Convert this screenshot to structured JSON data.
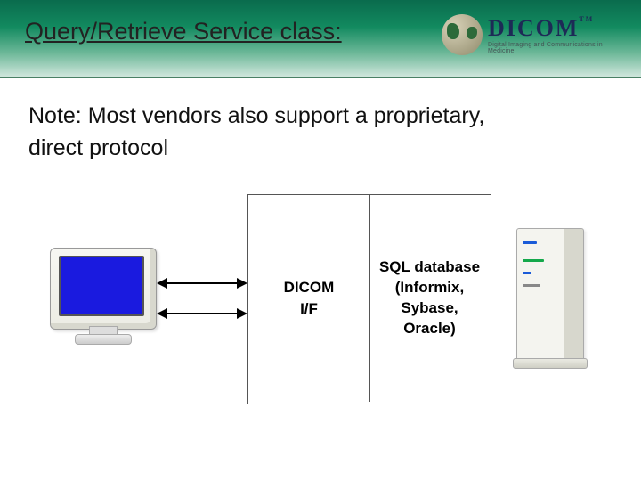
{
  "header": {
    "title": "Query/Retrieve Service class:",
    "logo_main": "DICOM",
    "logo_tm": "TM",
    "logo_sub": "Digital Imaging and Communications in Medicine"
  },
  "note_line1": "Note: Most vendors also support a proprietary,",
  "note_line2": "direct protocol",
  "diagram": {
    "dicom_if": "DICOM\nI/F",
    "db": "SQL database (Informix, Sybase, Oracle)"
  }
}
